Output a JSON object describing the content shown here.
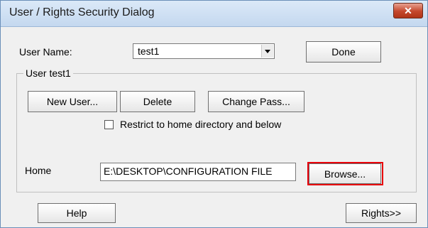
{
  "window": {
    "title": "User / Rights Security Dialog",
    "close_glyph": "✕"
  },
  "user_name": {
    "label": "User Name:",
    "selected": "test1"
  },
  "buttons": {
    "done": "Done",
    "new_user": "New User...",
    "delete": "Delete",
    "change_pass": "Change Pass...",
    "browse": "Browse...",
    "help": "Help",
    "rights": "Rights>>"
  },
  "group": {
    "title": "User test1"
  },
  "restrict": {
    "label": "Restrict to home directory and below",
    "checked": false
  },
  "home": {
    "label": "Home",
    "value": "E:\\DESKTOP\\CONFIGURATION FILE"
  },
  "colors": {
    "highlight": "#e8000a",
    "titlebar": "#c4d8ef"
  }
}
